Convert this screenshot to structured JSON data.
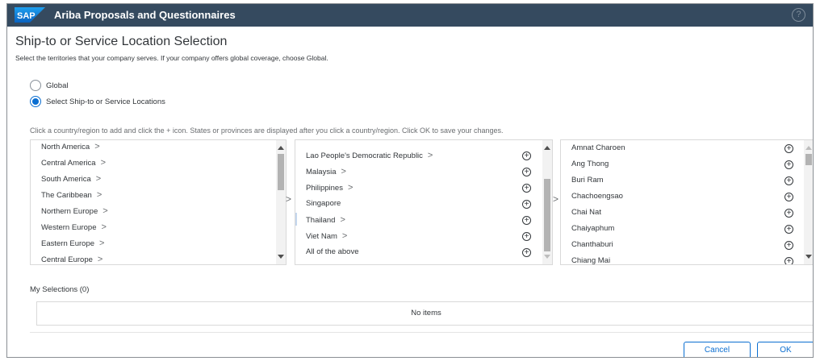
{
  "shellbar": {
    "logo_text": "SAP",
    "title": "Ariba Proposals and Questionnaires",
    "caret": "⌄",
    "help": "?"
  },
  "page": {
    "title": "Ship-to or Service Location Selection",
    "description": "Select the territories that your company serves. If your company offers global coverage, choose Global."
  },
  "options": {
    "global_label": "Global",
    "select_label": "Select Ship-to or Service Locations",
    "selected": "select"
  },
  "instruction": "Click a country/region to add and click the + icon. States or provinces are displayed after you click a country/region. Click OK to save your changes.",
  "regions": [
    {
      "label": "North America"
    },
    {
      "label": "Central America"
    },
    {
      "label": "South America"
    },
    {
      "label": "The Caribbean"
    },
    {
      "label": "Northern Europe"
    },
    {
      "label": "Western Europe"
    },
    {
      "label": "Eastern Europe"
    },
    {
      "label": "Central Europe"
    }
  ],
  "countries": [
    {
      "label": "Lao People's Democratic Republic",
      "has_children": true
    },
    {
      "label": "Malaysia",
      "has_children": true
    },
    {
      "label": "Philippines",
      "has_children": true
    },
    {
      "label": "Singapore",
      "has_children": false
    },
    {
      "label": "Thailand",
      "has_children": true
    },
    {
      "label": "Viet Nam",
      "has_children": true
    },
    {
      "label": "All of the above",
      "has_children": false
    }
  ],
  "provinces": [
    {
      "label": "Amnat Charoen"
    },
    {
      "label": "Ang Thong"
    },
    {
      "label": "Buri Ram"
    },
    {
      "label": "Chachoengsao"
    },
    {
      "label": "Chai Nat"
    },
    {
      "label": "Chaiyaphum"
    },
    {
      "label": "Chanthaburi"
    },
    {
      "label": "Chiang Mai"
    }
  ],
  "chevron": ">",
  "plus_glyph": "+",
  "my_selections": {
    "label": "My Selections (0)",
    "empty_text": "No items"
  },
  "buttons": {
    "cancel": "Cancel",
    "ok": "OK"
  },
  "colors": {
    "shellbar": "#354a5f",
    "accent": "#0a6ed1"
  }
}
